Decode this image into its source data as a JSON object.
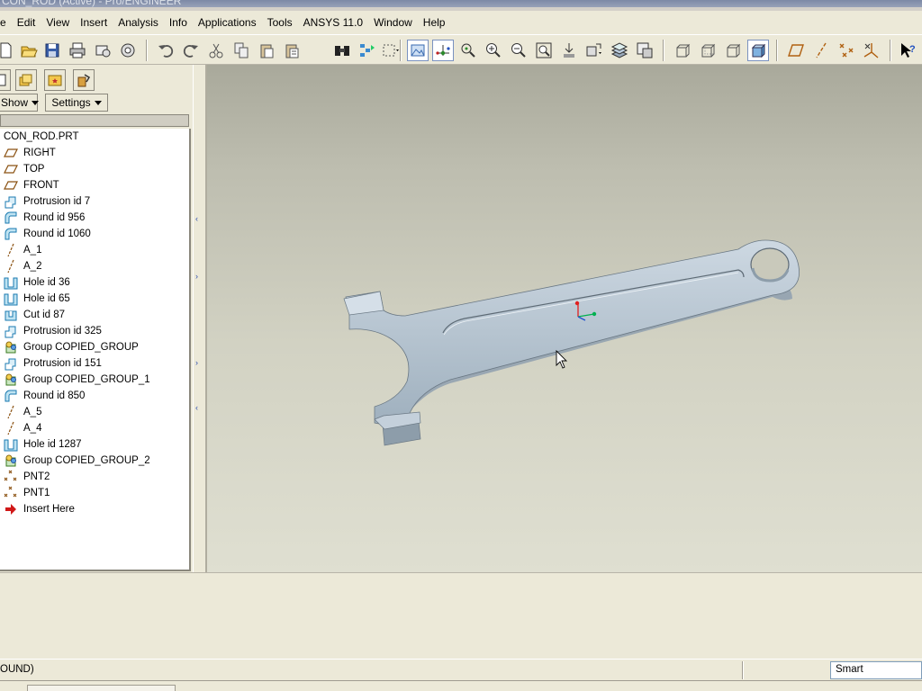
{
  "window": {
    "title": "CON_ROD (Active) - Pro/ENGINEER"
  },
  "menu": [
    "e",
    "Edit",
    "View",
    "Insert",
    "Analysis",
    "Info",
    "Applications",
    "Tools",
    "ANSYS 11.0",
    "Window",
    "Help"
  ],
  "toolbar": {
    "icons": [
      "new-icon",
      "open-icon",
      "save-icon",
      "print-icon",
      "send-mail-icon",
      "erase-icon",
      "undo-icon",
      "redo-icon",
      "cut-icon",
      "copy-icon",
      "paste-icon",
      "paste-special-icon",
      "find-icon",
      "regenerate-icon",
      "selection-box-icon",
      "datum-plane-display-icon",
      "datum-axis-display-icon",
      "point-display-icon",
      "zoom-in-icon",
      "zoom-out-icon",
      "refit-icon",
      "reorient-icon",
      "named-views-icon",
      "layers-icon",
      "view-manager-icon",
      "wireframe-icon",
      "hidden-line-icon",
      "no-hidden-icon",
      "shading-icon",
      "datum-plane-tool-icon",
      "datum-axis-tool-icon",
      "datum-point-tool-icon",
      "csys-tool-icon",
      "context-help-icon"
    ]
  },
  "panel": {
    "show_label": "Show",
    "settings_label": "Settings",
    "tree": [
      {
        "label": "CON_ROD.PRT",
        "icon": "part-icon"
      },
      {
        "label": "RIGHT",
        "icon": "datum-plane-icon"
      },
      {
        "label": "TOP",
        "icon": "datum-plane-icon"
      },
      {
        "label": "FRONT",
        "icon": "datum-plane-icon"
      },
      {
        "label": "Protrusion id 7",
        "icon": "protrusion-icon"
      },
      {
        "label": "Round id 956",
        "icon": "round-icon"
      },
      {
        "label": "Round id 1060",
        "icon": "round-icon"
      },
      {
        "label": "A_1",
        "icon": "datum-axis-icon"
      },
      {
        "label": "A_2",
        "icon": "datum-axis-icon"
      },
      {
        "label": "Hole id 36",
        "icon": "hole-icon"
      },
      {
        "label": "Hole id 65",
        "icon": "hole-icon"
      },
      {
        "label": "Cut id 87",
        "icon": "cut-feature-icon"
      },
      {
        "label": "Protrusion id 325",
        "icon": "protrusion-icon"
      },
      {
        "label": "Group COPIED_GROUP",
        "icon": "group-icon"
      },
      {
        "label": "Protrusion id 151",
        "icon": "protrusion-icon"
      },
      {
        "label": "Group COPIED_GROUP_1",
        "icon": "group-icon"
      },
      {
        "label": "Round id 850",
        "icon": "round-icon"
      },
      {
        "label": "A_5",
        "icon": "datum-axis-icon"
      },
      {
        "label": "A_4",
        "icon": "datum-axis-icon"
      },
      {
        "label": "Hole id 1287",
        "icon": "hole-icon"
      },
      {
        "label": "Group COPIED_GROUP_2",
        "icon": "group-icon"
      },
      {
        "label": "PNT2",
        "icon": "datum-point-icon"
      },
      {
        "label": "PNT1",
        "icon": "datum-point-icon"
      },
      {
        "label": "Insert Here",
        "icon": "insert-here-arrow-icon"
      }
    ]
  },
  "status": {
    "message": "OUND)",
    "filter": "Smart"
  },
  "colors": {
    "model": "#b7c6d2",
    "viewport_top": "#a9a99b",
    "viewport_bottom": "#dfdfd1",
    "axis_x": "#00b050",
    "axis_y": "#e02020"
  }
}
